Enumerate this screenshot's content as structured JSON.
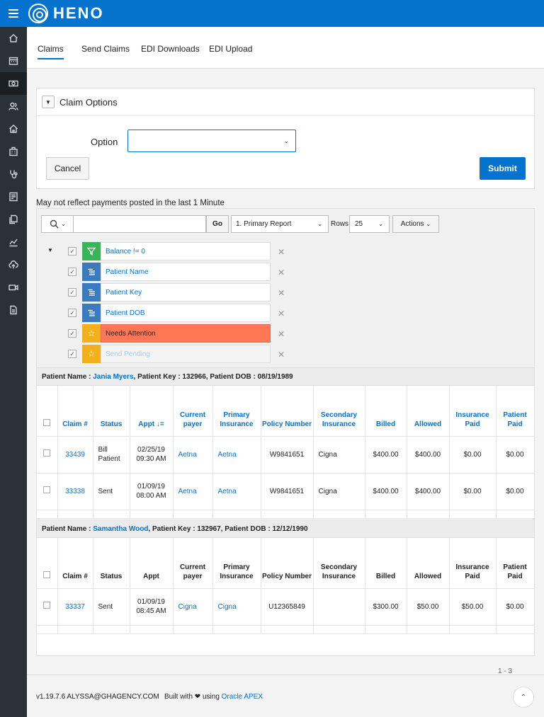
{
  "brand": {
    "name": "HENO"
  },
  "sidebar": {
    "items": [
      {
        "icon": "home-icon"
      },
      {
        "icon": "calendar-icon"
      },
      {
        "icon": "money-icon"
      },
      {
        "icon": "users-icon"
      },
      {
        "icon": "house-icon"
      },
      {
        "icon": "building-icon"
      },
      {
        "icon": "stethoscope-icon"
      },
      {
        "icon": "report-icon"
      },
      {
        "icon": "documents-icon"
      },
      {
        "icon": "chart-icon"
      },
      {
        "icon": "cloud-upload-icon"
      },
      {
        "icon": "video-icon"
      },
      {
        "icon": "file-icon"
      }
    ]
  },
  "tabs": [
    {
      "label": "Claims"
    },
    {
      "label": "Send Claims"
    },
    {
      "label": "EDI Downloads"
    },
    {
      "label": "EDI Upload"
    }
  ],
  "claim_options": {
    "title": "Claim Options",
    "option_label": "Option",
    "option_value": "",
    "cancel_label": "Cancel",
    "submit_label": "Submit"
  },
  "notice": "May not reflect payments posted in the last 1 Minute",
  "toolbar": {
    "go_label": "Go",
    "report_label": "1. Primary Report",
    "rows_label": "Rows",
    "rows_value": "25",
    "actions_label": "Actions"
  },
  "filters": [
    {
      "label": "Balance != 0",
      "icon": "filter-icon"
    },
    {
      "label": "Patient Name",
      "icon": "group-icon"
    },
    {
      "label": "Patient Key",
      "icon": "group-icon"
    },
    {
      "label": "Patient DOB",
      "icon": "group-icon"
    },
    {
      "label": "Needs Attention",
      "icon": "star-icon"
    },
    {
      "label": "Send Pending",
      "icon": "star-icon"
    }
  ],
  "groups": [
    {
      "prefix": "Patient Name :",
      "name": "Jania Myers",
      "rest": ", Patient Key : 132966, Patient DOB : 08/19/1989",
      "headers": [
        "Claim #",
        "Status",
        "Appt",
        "Current payer",
        "Primary Insurance",
        "Policy Number",
        "Secondary Insurance",
        "Billed",
        "Allowed",
        "Insurance Paid",
        "Patient Paid"
      ],
      "rows": [
        {
          "claim": "33439",
          "status": "Bill Patient",
          "appt": "02/25/19 09:30 AM",
          "payer": "Aetna",
          "primary": "Aetna",
          "policy": "W9841651",
          "secondary": "Cigna",
          "billed": "$400.00",
          "allowed": "$400.00",
          "ins_paid": "$0.00",
          "pat_paid": "$0.00"
        },
        {
          "claim": "33338",
          "status": "Sent",
          "appt": "01/09/19 08:00 AM",
          "payer": "Aetna",
          "primary": "Aetna",
          "policy": "W9841651",
          "secondary": "Cigna",
          "billed": "$400.00",
          "allowed": "$400.00",
          "ins_paid": "$0.00",
          "pat_paid": "$0.00"
        }
      ]
    },
    {
      "prefix": "Patient Name :",
      "name": "Samantha Wood",
      "rest": ", Patient Key : 132967, Patient DOB : 12/12/1990",
      "headers": [
        "Claim #",
        "Status",
        "Appt",
        "Current payer",
        "Primary Insurance",
        "Policy Number",
        "Secondary Insurance",
        "Billed",
        "Allowed",
        "Insurance Paid",
        "Patient Paid"
      ],
      "rows": [
        {
          "claim": "33337",
          "status": "Sent",
          "appt": "01/09/19 08:45 AM",
          "payer": "Cigna",
          "primary": "Cigna",
          "policy": "U12365849",
          "secondary": "",
          "billed": "$300.00",
          "allowed": "$50.00",
          "ins_paid": "$50.00",
          "pat_paid": "$0.00"
        }
      ]
    }
  ],
  "pagination": "1 - 3",
  "footer": {
    "version": "v1.19.7.6 ALYSSA@GHAGENCY.COM",
    "built_pre": "Built with",
    "built_mid": "using",
    "built_link": "Oracle APEX"
  }
}
